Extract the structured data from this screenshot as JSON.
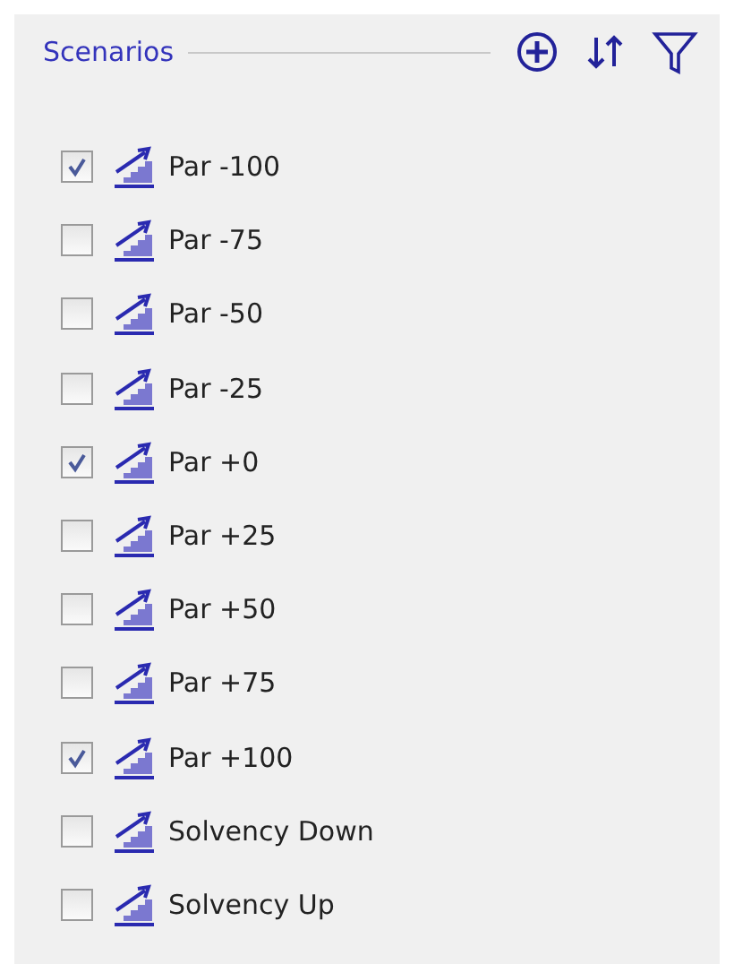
{
  "header": {
    "title": "Scenarios"
  },
  "scenarios": [
    {
      "label": "Par -100",
      "checked": true
    },
    {
      "label": "Par -75",
      "checked": false
    },
    {
      "label": "Par -50",
      "checked": false
    },
    {
      "label": "Par -25",
      "checked": false
    },
    {
      "label": "Par +0",
      "checked": true
    },
    {
      "label": "Par +25",
      "checked": false
    },
    {
      "label": "Par +50",
      "checked": false
    },
    {
      "label": "Par +75",
      "checked": false
    },
    {
      "label": "Par +100",
      "checked": true
    },
    {
      "label": "Solvency Down",
      "checked": false
    },
    {
      "label": "Solvency Up",
      "checked": false
    }
  ]
}
